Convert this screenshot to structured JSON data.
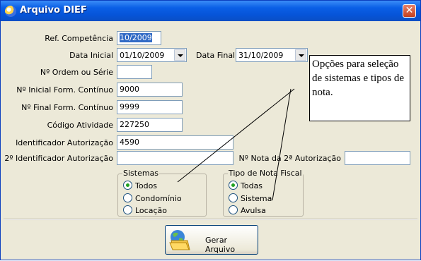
{
  "window": {
    "title": "Arquivo DIEF",
    "close_glyph": "✕"
  },
  "fields": {
    "ref_competencia": {
      "label": "Ref. Competência",
      "value": "10/2009"
    },
    "data_inicial": {
      "label": "Data Inicial",
      "value": "01/10/2009"
    },
    "data_final": {
      "label": "Data Final",
      "value": "31/10/2009"
    },
    "ordem_serie": {
      "label": "Nº Ordem ou Série",
      "value": ""
    },
    "inicial_form": {
      "label": "Nº Inicial Form. Contínuo",
      "value": "9000"
    },
    "final_form": {
      "label": "Nº Final Form. Contínuo",
      "value": "9999"
    },
    "codigo_atividade": {
      "label": "Código Atividade",
      "value": "227250"
    },
    "ident_autorizacao": {
      "label": "Identificador Autorização",
      "value": "4590"
    },
    "ident_autorizacao_2": {
      "label": "2º Identificador Autorização",
      "value": ""
    },
    "nota_2_autorizacao": {
      "label": "Nº Nota da 2ª Autorização",
      "value": ""
    }
  },
  "sistemas": {
    "title": "Sistemas",
    "options": [
      "Todos",
      "Condomínio",
      "Locação"
    ],
    "selected": "Todos"
  },
  "tipo_nota": {
    "title": "Tipo de Nota Fiscal",
    "options": [
      "Todas",
      "Sistema",
      "Avulsa"
    ],
    "selected": "Todas"
  },
  "generate_button": {
    "label": "Gerar Arquivo",
    "icon": "folder-globe-icon"
  },
  "callout": {
    "text": "Opções para seleção de sistemas e tipos de nota."
  },
  "colors": {
    "title_bar": "#0a5fe6",
    "dialog_bg": "#ece9d8",
    "selection": "#316ac5"
  }
}
